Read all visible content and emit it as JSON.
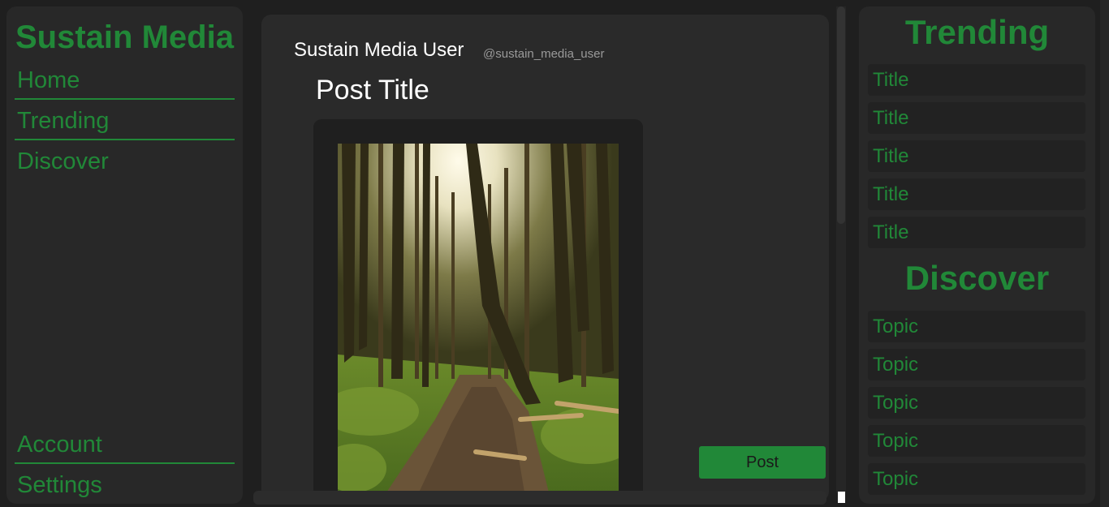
{
  "brand": {
    "name": "Sustain Media",
    "color": "#218838"
  },
  "nav": {
    "top_items": [
      {
        "label": "Home"
      },
      {
        "label": "Trending"
      },
      {
        "label": "Discover"
      }
    ],
    "bottom_items": [
      {
        "label": "Account"
      },
      {
        "label": "Settings"
      }
    ]
  },
  "post": {
    "user_name": "Sustain Media User",
    "user_handle": "@sustain_media_user",
    "title": "Post Title",
    "image": "forest-path-photo",
    "post_button_label": "Post"
  },
  "trending": {
    "heading": "Trending",
    "items": [
      "Title",
      "Title",
      "Title",
      "Title",
      "Title"
    ]
  },
  "discover": {
    "heading": "Discover",
    "items": [
      "Topic",
      "Topic",
      "Topic",
      "Topic",
      "Topic"
    ]
  }
}
